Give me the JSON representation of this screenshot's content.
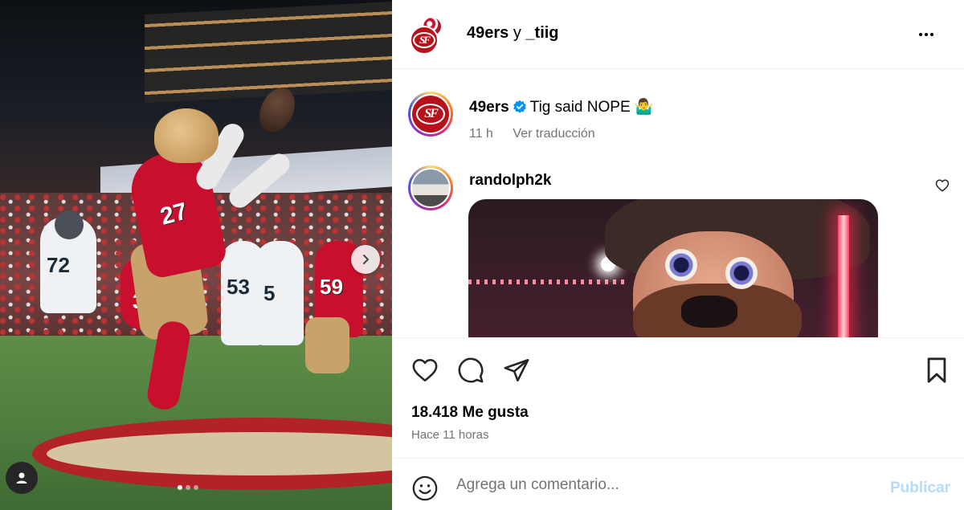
{
  "media": {
    "jersey_numbers": [
      "27",
      "72",
      "53",
      "5",
      "59",
      "33"
    ],
    "carousel": {
      "total": 3,
      "active": 1
    },
    "icons": {
      "next": "chevron-right-icon",
      "tag": "user-tag-icon"
    }
  },
  "header": {
    "account_name": "49ers",
    "connector": "y",
    "collaborator": "_tiig",
    "more_icon": "more-options-icon"
  },
  "caption": {
    "username": "49ers",
    "text": "Tig said NOPE",
    "emoji": "🤷‍♂️",
    "time": "11 h",
    "translate": "Ver traducción",
    "logo_text": "SF"
  },
  "comments": [
    {
      "username": "randolph2k",
      "has_gif": true
    }
  ],
  "actions": {
    "likes": "18.418 Me gusta",
    "time_ago": "Hace 11 horas"
  },
  "add_comment": {
    "placeholder": "Agrega un comentario...",
    "publish_label": "Publicar"
  },
  "colors": {
    "brand_red": "#b5121b",
    "verified_blue": "#0095f6",
    "publish_disabled": "#b3dbff"
  }
}
